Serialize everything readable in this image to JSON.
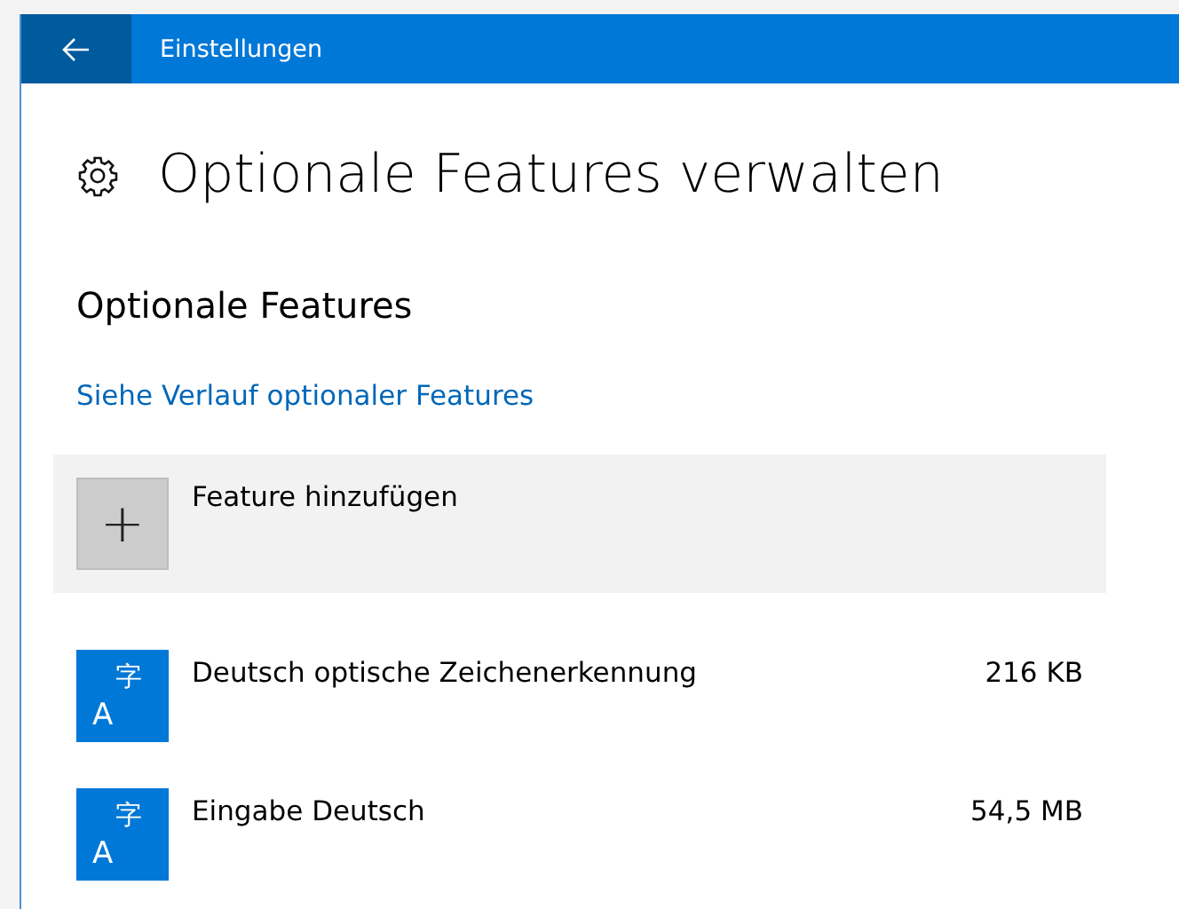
{
  "window": {
    "title": "Einstellungen"
  },
  "page_title": "Optionale Features verwalten",
  "section_title": "Optionale Features",
  "history_link": "Siehe Verlauf optionaler Features",
  "add_button": {
    "plus": "+",
    "label": "Feature hinzufügen"
  },
  "features": [
    {
      "icon_letter": "A",
      "icon_char": "字",
      "name": "Deutsch optische Zeichenerkennung",
      "size": "216 KB"
    },
    {
      "icon_letter": "A",
      "icon_char": "字",
      "name": "Eingabe Deutsch",
      "size": "54,5 MB"
    }
  ]
}
